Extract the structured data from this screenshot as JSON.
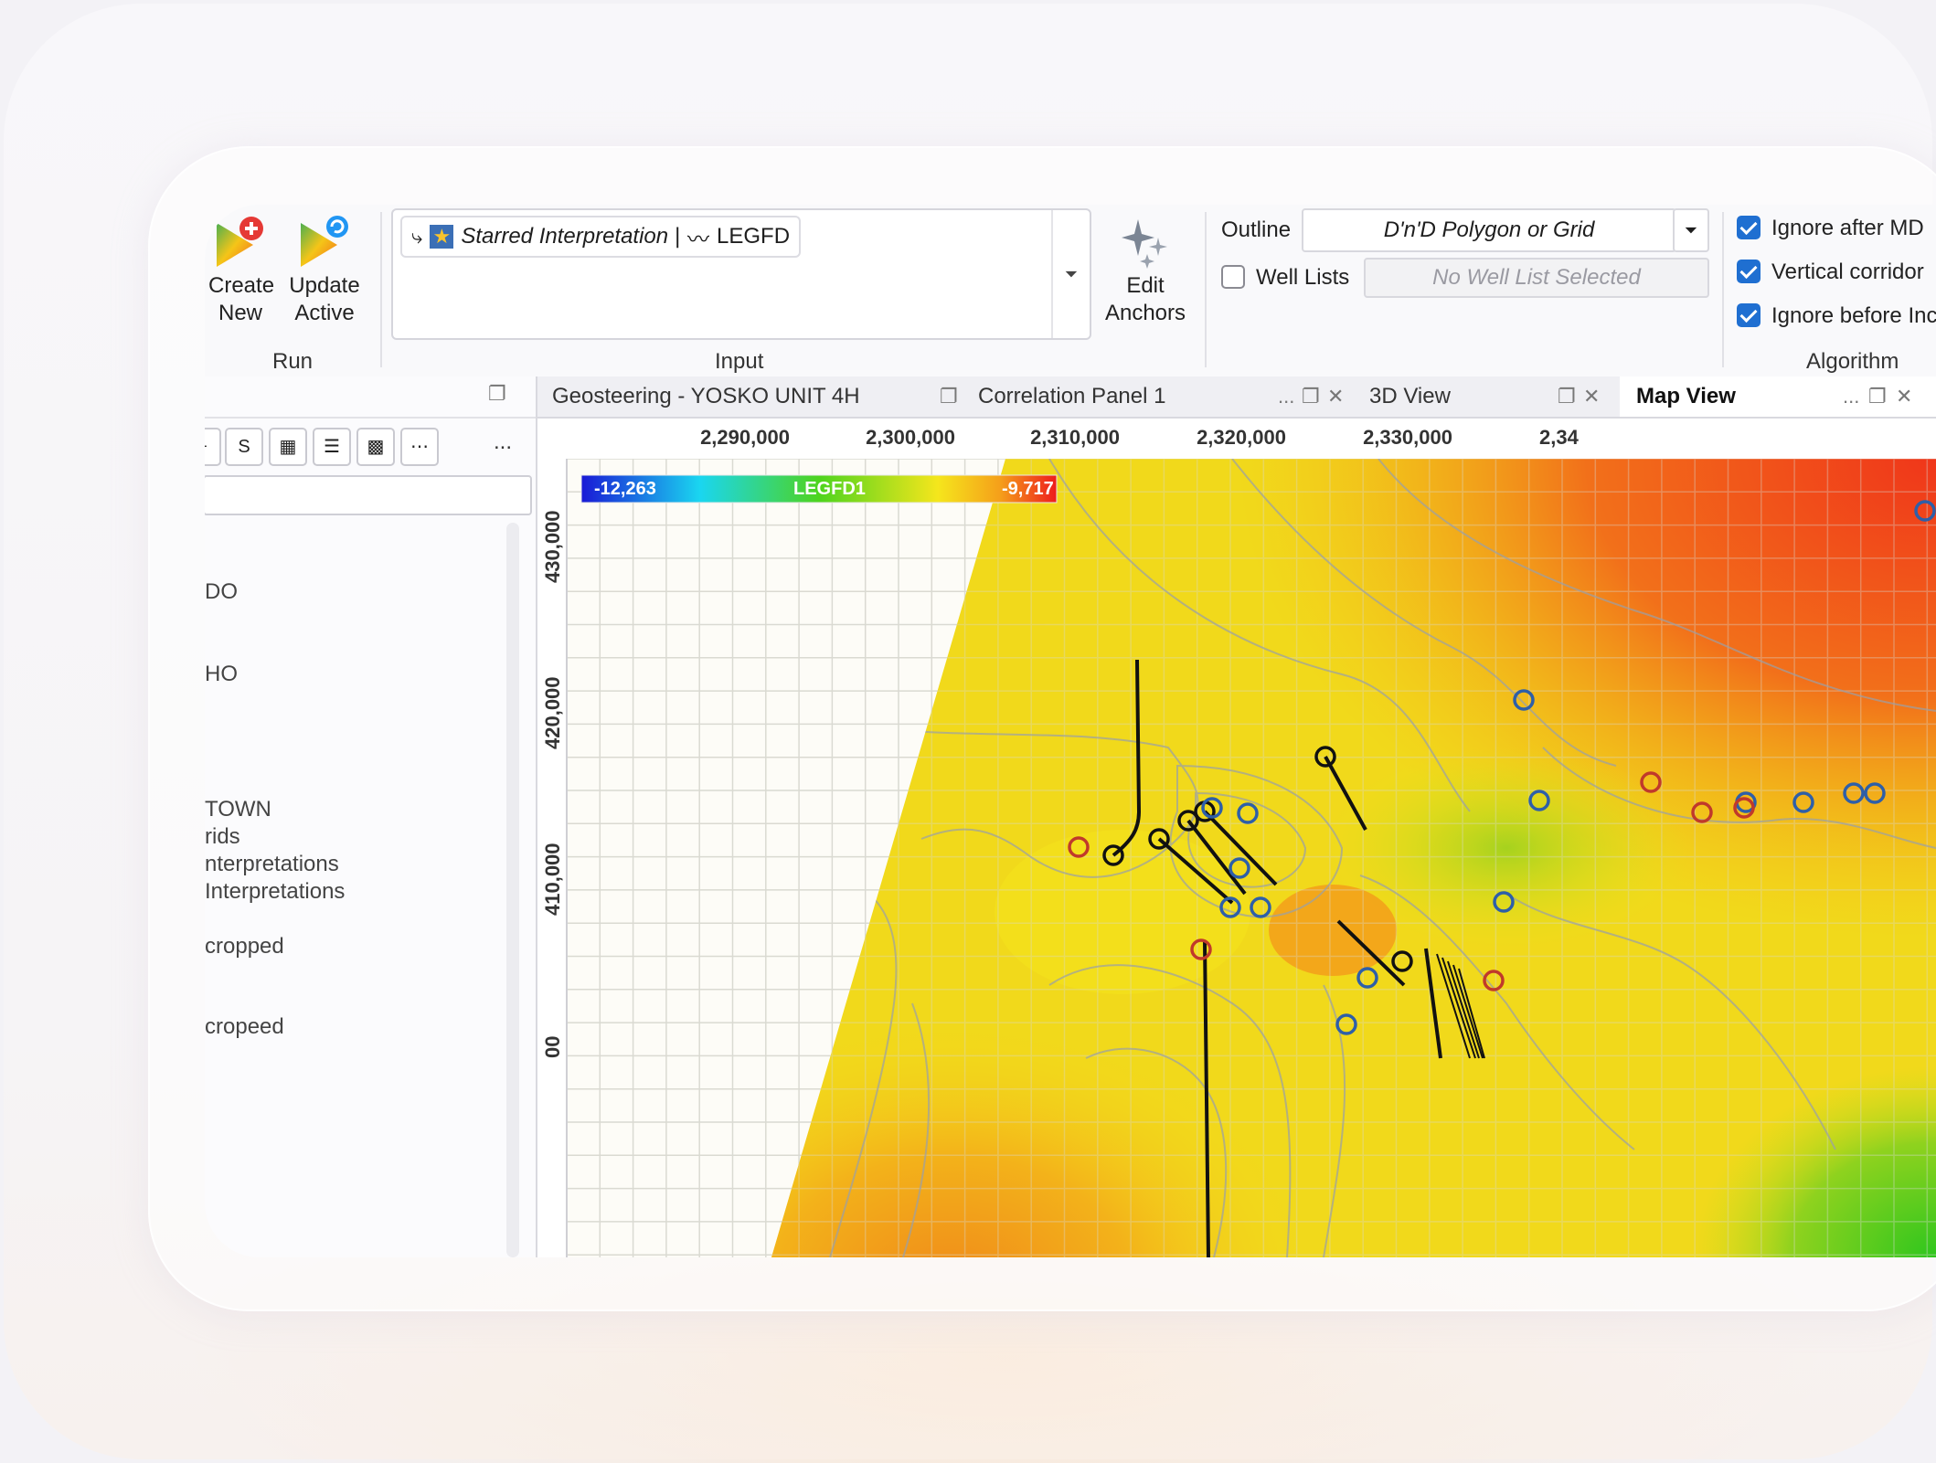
{
  "ribbon": {
    "run": {
      "create_new_line1": "Create",
      "create_new_line2": "New",
      "update_active_line1": "Update",
      "update_active_line2": "Active",
      "group_label": "Run"
    },
    "input": {
      "chip_text": "Starred Interpretation |",
      "chip_log": "LEGFD",
      "group_label": "Input"
    },
    "edit_anchors_line1": "Edit",
    "edit_anchors_line2": "Anchors",
    "outline_label": "Outline",
    "outline_placeholder": "D'n'D Polygon or Grid",
    "well_lists_label": "Well Lists",
    "well_list_value": "No Well List Selected",
    "algorithm": {
      "ignore_after_md": "Ignore after MD",
      "vertical_corridor": "Vertical corridor",
      "ignore_before_incl": "Ignore before Incl.",
      "group_label": "Algorithm"
    }
  },
  "left_panel": {
    "overflow_label": "...",
    "tree_items": [
      "DO",
      "HO",
      "TOWN",
      "rids",
      "nterpretations",
      "Interpretations",
      "cropped",
      "cropeed"
    ]
  },
  "tabs": [
    {
      "label": "Geosteering - YOSKO UNIT 4H",
      "active": false
    },
    {
      "label": "Correlation Panel 1",
      "active": false
    },
    {
      "label": "3D View",
      "active": false
    },
    {
      "label": "Map View",
      "active": true
    }
  ],
  "tab_more": "...",
  "map": {
    "x_ticks": [
      "2,290,000",
      "2,300,000",
      "2,310,000",
      "2,320,000",
      "2,330,000",
      "2,34"
    ],
    "y_ticks": [
      "430,000",
      "420,000",
      "410,000",
      "00"
    ],
    "colorbar": {
      "min": "-12,263",
      "label": "LEGFD1",
      "max": "-9,717"
    },
    "colors": {
      "blue_well": "#2e5fa8",
      "red_well": "#c0392b",
      "trajectory": "#111111"
    }
  }
}
